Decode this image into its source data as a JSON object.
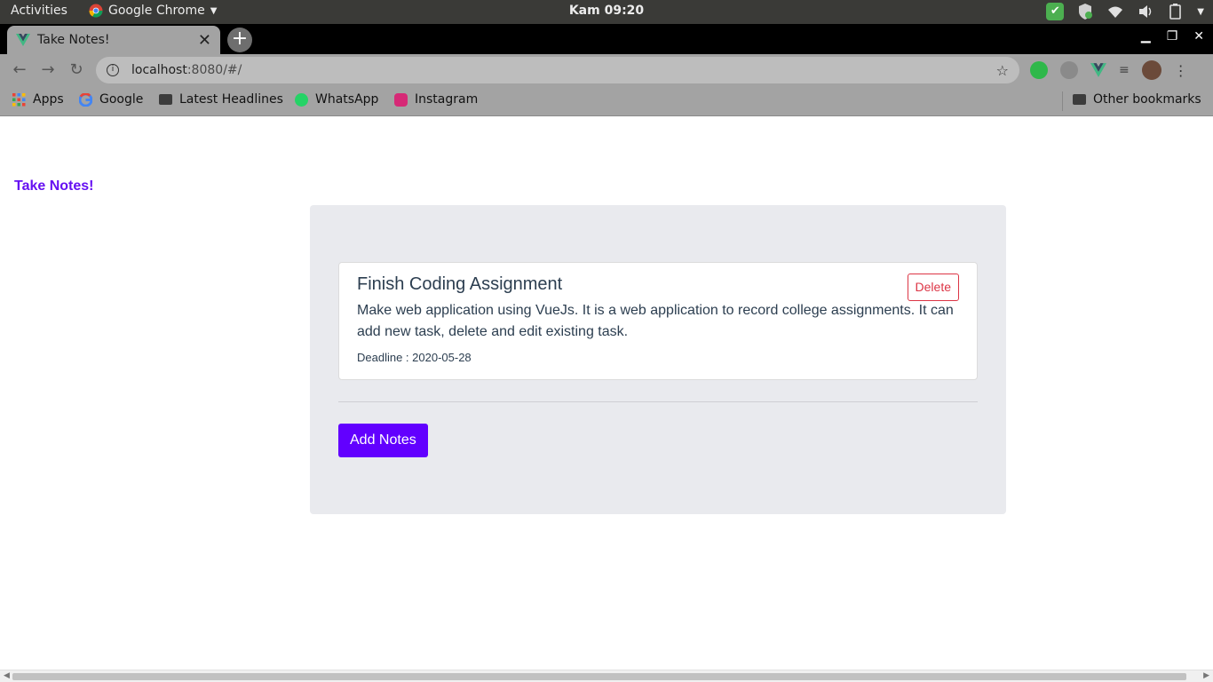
{
  "os_bar": {
    "activities": "Activities",
    "app_name": "Google Chrome",
    "clock": "Kam 09:20"
  },
  "browser": {
    "tab_title": "Take Notes!",
    "tab_close": "✕",
    "url_host": "localhost",
    "url_path": ":8080/#/",
    "bookmarks": [
      "Apps",
      "Google",
      "Latest Headlines",
      "WhatsApp",
      "Instagram"
    ],
    "other_bookmarks": "Other bookmarks"
  },
  "app": {
    "brand": "Take Notes!",
    "notes": [
      {
        "title": "Finish Coding Assignment",
        "description": "Make web application using VueJs. It is a web application to record college assignments. It can add new task, delete and edit existing task.",
        "deadline": "Deadline : 2020-05-28",
        "delete_label": "Delete"
      }
    ],
    "add_label": "Add Notes"
  },
  "colors": {
    "brand": "#6610f2",
    "primary_button": "#6200ff",
    "danger": "#dc3545",
    "panel_bg": "#e9eaee"
  }
}
